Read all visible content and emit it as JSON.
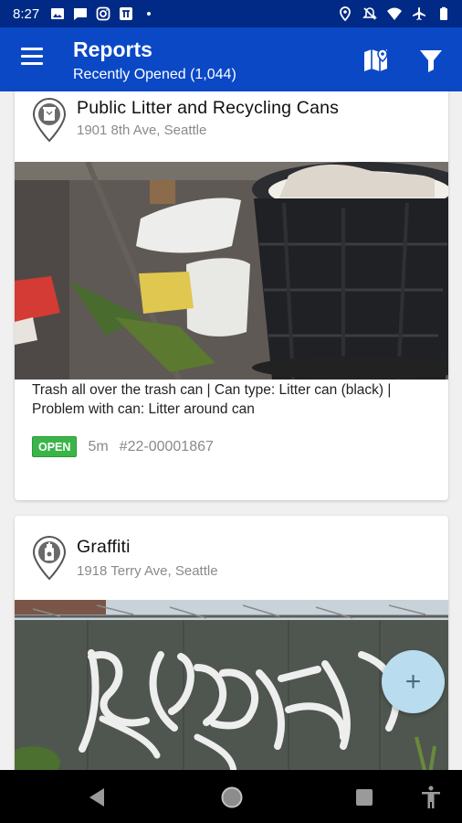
{
  "status_bar": {
    "time": "8:27",
    "left_icons": [
      "image-icon",
      "message-icon",
      "instagram-icon",
      "app-icon",
      "dot-icon"
    ],
    "right_icons": [
      "location-icon",
      "mute-icon",
      "wifi-icon",
      "airplane-icon",
      "battery-icon"
    ]
  },
  "app_bar": {
    "title": "Reports",
    "subtitle": "Recently Opened (1,044)",
    "background": "#0a48c6",
    "status_background": "#002a86"
  },
  "reports": [
    {
      "category": "Public Litter and Recycling Cans",
      "address": "1901 8th Ave, Seattle",
      "icon": "trash-can-icon",
      "description": "Trash all over the trash can | Can type: Litter can (black) | Problem with can: Litter around can",
      "status": "OPEN",
      "age": "5m",
      "ticket": "#22-00001867"
    },
    {
      "category": "Graffiti",
      "address": "1918 Terry Ave, Seattle",
      "icon": "spray-can-icon"
    }
  ],
  "fab": {
    "symbol": "+"
  },
  "colors": {
    "open_badge": "#3bb54a",
    "fab": "#b9dcef"
  }
}
